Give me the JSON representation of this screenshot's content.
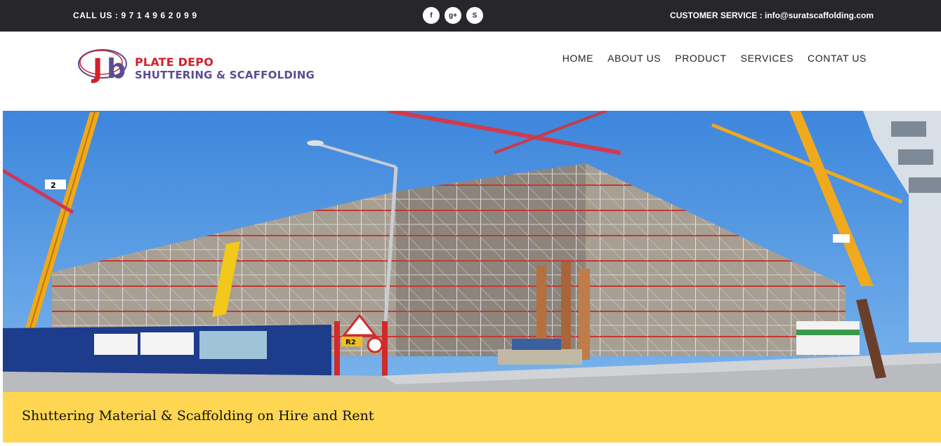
{
  "topbar": {
    "call": "CALL US : 9 7 1 4 9 6 2 0 9 9",
    "customer_service": "CUSTOMER SERVICE : info@suratscaffolding.com",
    "social": [
      {
        "name": "facebook-icon",
        "glyph": "f"
      },
      {
        "name": "google-plus-icon",
        "glyph": "g+"
      },
      {
        "name": "skype-icon",
        "glyph": "S"
      }
    ]
  },
  "logo": {
    "line1": "PLATE DEPO",
    "line2": "SHUTTERING & SCAFFOLDING",
    "colors": {
      "red": "#d3202a",
      "purple": "#5b4d92"
    }
  },
  "nav": {
    "items": [
      "HOME",
      "ABOUT US",
      "PRODUCT",
      "SERVICES",
      "CONTAT US"
    ]
  },
  "hero": {
    "sign": "R2"
  },
  "banner": {
    "tagline": "Shuttering Material & Scaffolding on Hire and Rent",
    "color": "#fed652"
  },
  "colors": {
    "topbar": "#27262b",
    "sky": "#4c93e0",
    "crane": "#f0a91c"
  }
}
